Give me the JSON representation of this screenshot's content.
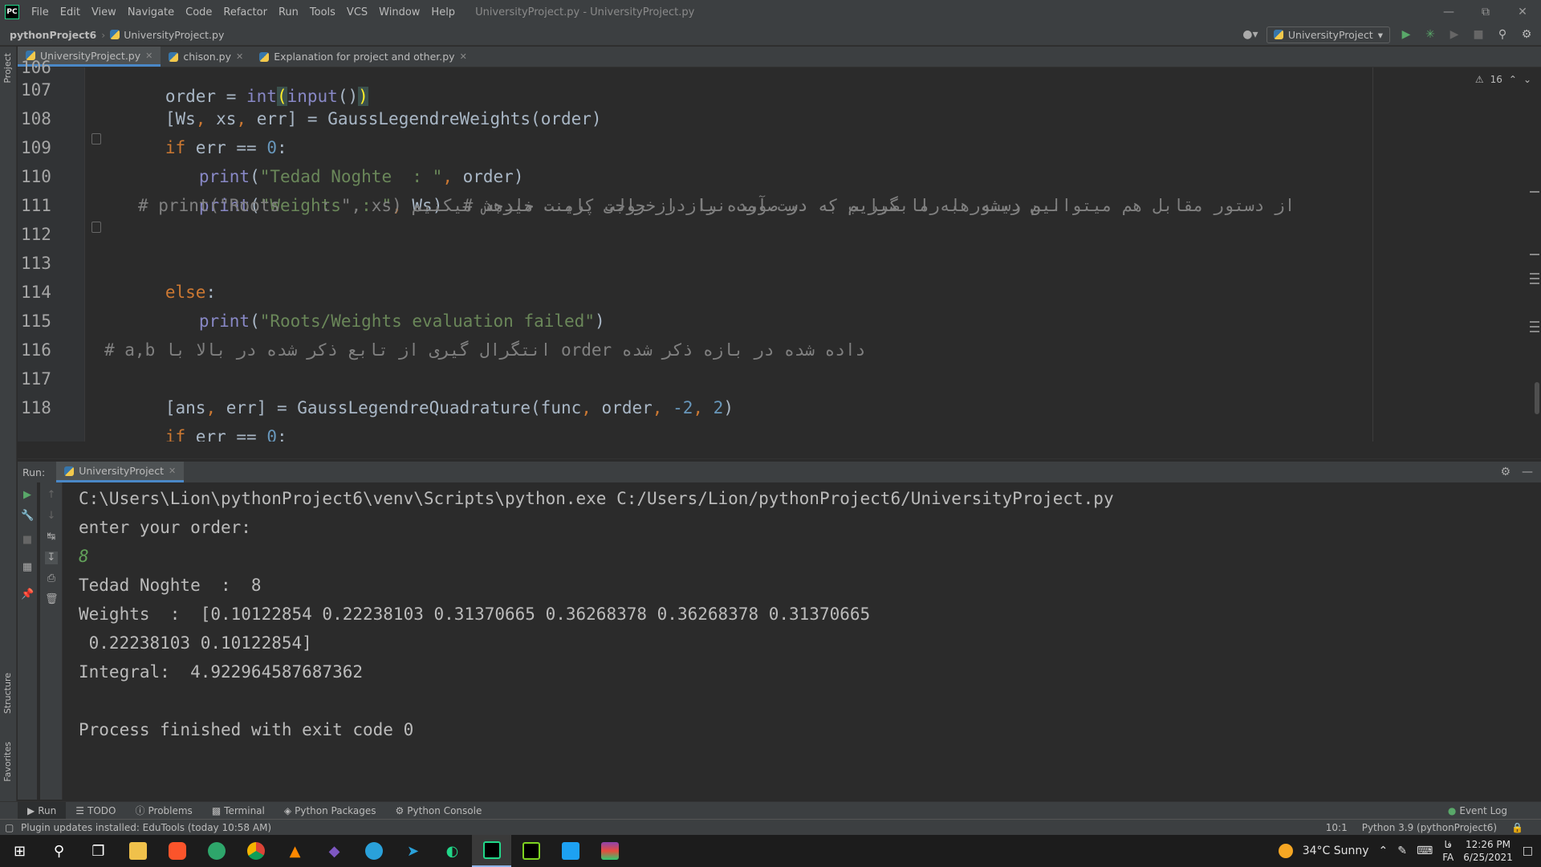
{
  "menu": {
    "app_logo": "PC",
    "items": [
      "File",
      "Edit",
      "View",
      "Navigate",
      "Code",
      "Refactor",
      "Run",
      "Tools",
      "VCS",
      "Window",
      "Help"
    ],
    "window_title": "UniversityProject.py - UniversityProject.py"
  },
  "navbar": {
    "project": "pythonProject6",
    "file": "UniversityProject.py",
    "run_config": "UniversityProject"
  },
  "editor_tabs": [
    {
      "label": "UniversityProject.py"
    },
    {
      "label": "chison.py"
    },
    {
      "label": "Explanation for project and other.py"
    }
  ],
  "editor": {
    "line_numbers": [
      "106",
      "107",
      "108",
      "109",
      "110",
      "111",
      "112",
      "113",
      "114",
      "115",
      "116",
      "117",
      "118"
    ],
    "warning_count": "16",
    "lines": {
      "l106": {
        "a": "order = ",
        "b": "int",
        "c": "(",
        "d": "input",
        "e": "()",
        "f": ")"
      },
      "l107": {
        "a": "[Ws",
        "b": ", ",
        "c": "xs",
        "d": ", ",
        "e": "err] = GaussLegendreWeights(order)"
      },
      "l108": {
        "a": "if ",
        "b": "err == ",
        "c": "0",
        "d": ":"
      },
      "l109": {
        "a": "print",
        "b": "(",
        "c": "\"Tedad Noghte  : \"",
        "d": ", ",
        "e": "order)"
      },
      "l110": {
        "a": "print",
        "b": "(",
        "c": "\"Weights  : \"",
        "d": ", ",
        "e": "Ws)  ",
        "f": "# این دستور به ما ضرایب به دست آمده را در خروجی پرینت میدهد"
      },
      "l111": {
        "a": "# print(\"Roots    : \", xs) از دستور مقابل هم میتوانیم ریشه ها را بگیریم که در صورت نیاز از حالت کامنت خارجش میکنیم"
      },
      "l113": {
        "a": "else",
        "b": ":"
      },
      "l114": {
        "a": "print",
        "b": "(",
        "c": "\"Roots/Weights evaluation failed\"",
        "d": ")"
      },
      "l116": {
        "a": "# a,b انتگرال گیری از تابع ذکر شده در بالا با order داده شده در بازه ذکر شده"
      },
      "l117": {
        "a": "[ans",
        "b": ", ",
        "c": "err] = GaussLegendreQuadrature(func",
        "d": ", ",
        "e": "order",
        "f": ", ",
        "g": "-2",
        "h": ", ",
        "i": "2",
        "j": ")"
      },
      "l118": {
        "a": "if ",
        "b": "err == ",
        "c": "0",
        "d": ":"
      }
    }
  },
  "run_panel": {
    "title": "Run:",
    "tab": "UniversityProject",
    "console": [
      "C:\\Users\\Lion\\pythonProject6\\venv\\Scripts\\python.exe C:/Users/Lion/pythonProject6/UniversityProject.py",
      "enter your order:",
      "8",
      "Tedad Noghte  :  8",
      "Weights  :  [0.10122854 0.22238103 0.31370665 0.36268378 0.36268378 0.31370665",
      " 0.22238103 0.10122854]",
      "Integral:  4.922964587687362",
      "",
      "Process finished with exit code 0"
    ]
  },
  "left_stripe": {
    "project": "Project",
    "structure": "Structure",
    "favorites": "Favorites"
  },
  "tool_windows": [
    "Run",
    "TODO",
    "Problems",
    "Terminal",
    "Python Packages",
    "Python Console"
  ],
  "event_log": "Event Log",
  "status_bar": {
    "message": "Plugin updates installed: EduTools (today 10:58 AM)",
    "position": "10:1",
    "interpreter": "Python 3.9 (pythonProject6)"
  },
  "taskbar": {
    "weather": "34°C  Sunny",
    "lang_top": "فا",
    "lang_bottom": "FA",
    "time": "12:26 PM",
    "date": "6/25/2021"
  },
  "colors": {
    "keyword": "#cc7832",
    "string": "#6a8759",
    "number": "#6897bb",
    "comment": "#808080",
    "builtin": "#8888c6",
    "accent": "#4a88c7"
  }
}
